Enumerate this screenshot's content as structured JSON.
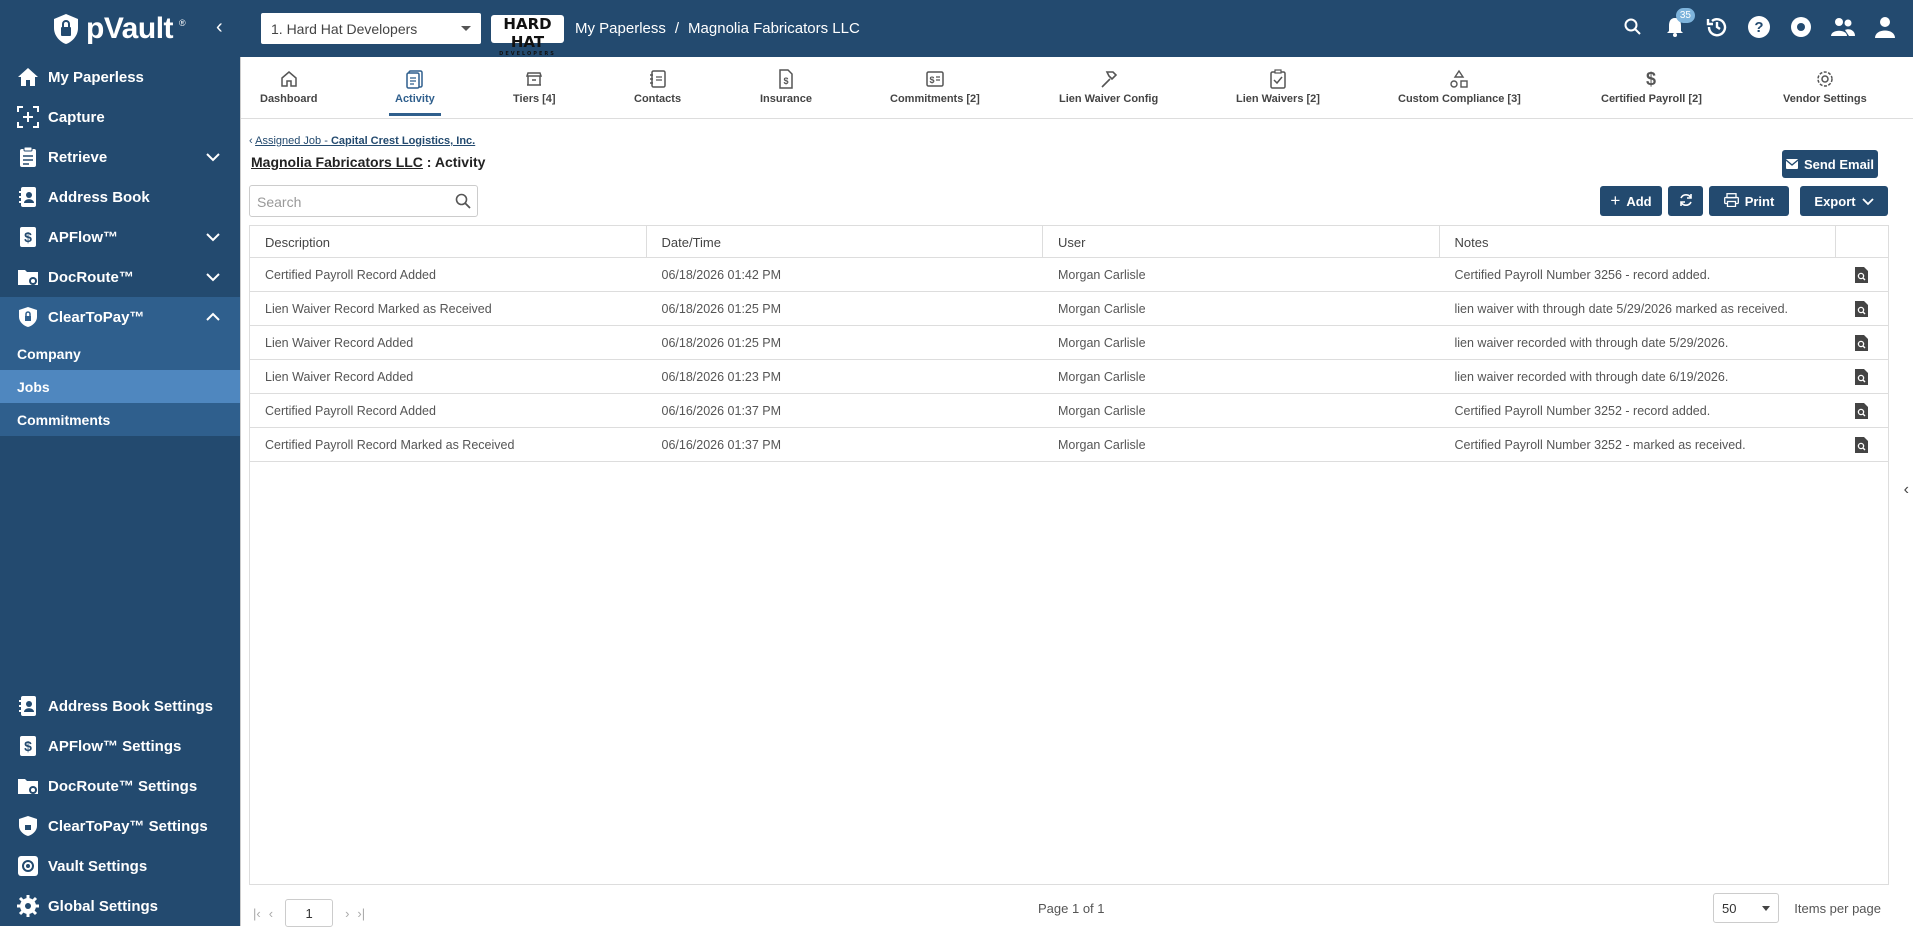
{
  "app": {
    "name": "pVault",
    "trademark": "®"
  },
  "topbar": {
    "company_select": "1. Hard Hat Developers",
    "company_logo_text": "HARD HAT",
    "company_logo_sub": "DEVELOPERS",
    "breadcrumb": [
      "My Paperless",
      "Magnolia Fabricators LLC"
    ],
    "notifications_count": "35"
  },
  "sidebar": {
    "items": [
      {
        "label": "My Paperless",
        "icon": "home-icon"
      },
      {
        "label": "Capture",
        "icon": "capture-icon"
      },
      {
        "label": "Retrieve",
        "icon": "clipboard-icon"
      },
      {
        "label": "Address Book",
        "icon": "address-book-icon"
      },
      {
        "label": "APFlow™",
        "icon": "dollar-doc-icon"
      },
      {
        "label": "DocRoute™",
        "icon": "folder-route-icon"
      },
      {
        "label": "ClearToPay™",
        "icon": "shield-icon"
      }
    ],
    "subitems": [
      "Company",
      "Jobs",
      "Commitments"
    ],
    "bottom": [
      {
        "label": "Address Book Settings",
        "icon": "address-book-icon"
      },
      {
        "label": "APFlow™ Settings",
        "icon": "dollar-doc-icon"
      },
      {
        "label": "DocRoute™ Settings",
        "icon": "folder-route-icon"
      },
      {
        "label": "ClearToPay™ Settings",
        "icon": "shield-icon"
      },
      {
        "label": "Vault Settings",
        "icon": "gear-icon"
      },
      {
        "label": "Global Settings",
        "icon": "gear-icon"
      }
    ]
  },
  "tabs": [
    {
      "label": "Dashboard",
      "icon": "home-icon"
    },
    {
      "label": "Activity",
      "icon": "activity-icon"
    },
    {
      "label": "Tiers [4]",
      "icon": "tiers-icon"
    },
    {
      "label": "Contacts",
      "icon": "contacts-icon"
    },
    {
      "label": "Insurance",
      "icon": "insurance-icon"
    },
    {
      "label": "Commitments [2]",
      "icon": "commitments-icon"
    },
    {
      "label": "Lien Waiver Config",
      "icon": "hammer-icon"
    },
    {
      "label": "Lien Waivers [2]",
      "icon": "clipboard-check-icon"
    },
    {
      "label": "Custom Compliance [3]",
      "icon": "shapes-icon"
    },
    {
      "label": "Certified Payroll [2]",
      "icon": "dollar-icon"
    },
    {
      "label": "Vendor Settings",
      "icon": "gear-icon"
    }
  ],
  "page": {
    "back_prefix": "Assigned Job - ",
    "back_job": "Capital Crest Logistics, Inc.",
    "title_vendor": "Magnolia Fabricators LLC",
    "title_suffix": " : Activity",
    "search_placeholder": "Search",
    "send_email": "Send Email",
    "add": "Add",
    "print": "Print",
    "export": "Export"
  },
  "table": {
    "columns": [
      "Description",
      "Date/Time",
      "User",
      "Notes"
    ],
    "rows": [
      [
        "Certified Payroll Record Added",
        "06/18/2026 01:42 PM",
        "Morgan Carlisle",
        "Certified Payroll Number 3256 - record added."
      ],
      [
        "Lien Waiver Record Marked as Received",
        "06/18/2026 01:25 PM",
        "Morgan Carlisle",
        "lien waiver with through date 5/29/2026 marked as received."
      ],
      [
        "Lien Waiver Record Added",
        "06/18/2026 01:25 PM",
        "Morgan Carlisle",
        "lien waiver recorded with through date 5/29/2026."
      ],
      [
        "Lien Waiver Record Added",
        "06/18/2026 01:23 PM",
        "Morgan Carlisle",
        "lien waiver recorded with through date 6/19/2026."
      ],
      [
        "Certified Payroll Record Added",
        "06/16/2026 01:37 PM",
        "Morgan Carlisle",
        "Certified Payroll Number 3252 - record added."
      ],
      [
        "Certified Payroll Record Marked as Received",
        "06/16/2026 01:37 PM",
        "Morgan Carlisle",
        "Certified Payroll Number 3252 - marked as received."
      ]
    ]
  },
  "pager": {
    "page": "1",
    "info": "Page 1 of 1",
    "per_page": "50",
    "per_page_label": "Items per page"
  }
}
